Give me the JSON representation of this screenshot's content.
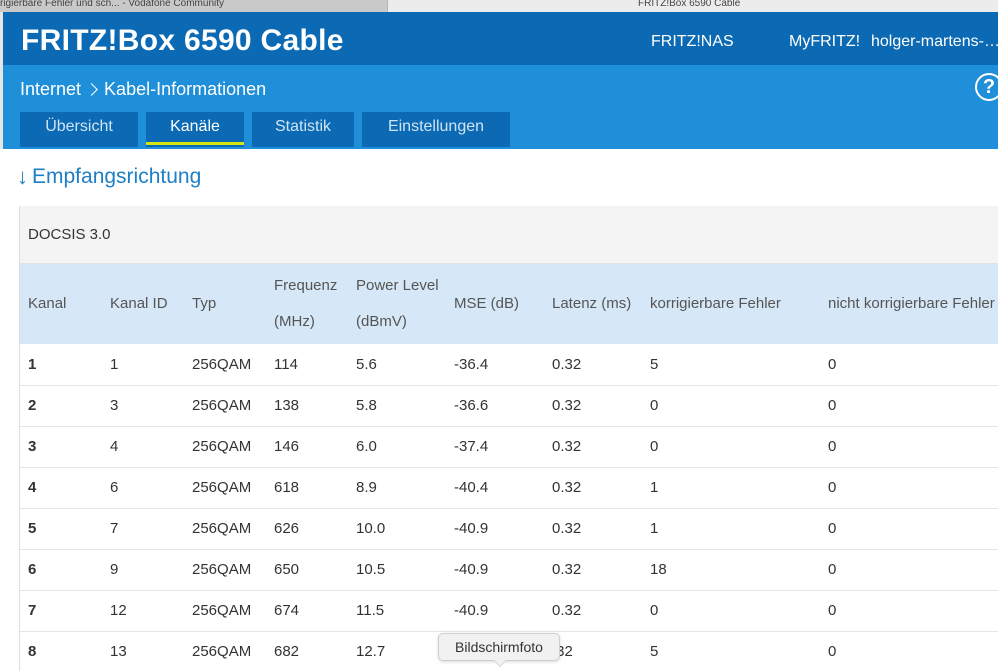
{
  "browser_tabs": [
    {
      "label": "rigierbare Fehler und sch... - Vodafone Community"
    },
    {
      "label": "FRITZ!Box 6590 Cable"
    }
  ],
  "header": {
    "brand": "FRITZ!Box 6590 Cable",
    "links": {
      "nas": "FRITZ!NAS",
      "myfritz": "MyFRITZ!",
      "user": "holger-martens-lo..."
    }
  },
  "breadcrumb": {
    "parent": "Internet",
    "current": "Kabel-Informationen"
  },
  "help_label": "?",
  "tabs": [
    {
      "label": "Übersicht",
      "active": false
    },
    {
      "label": "Kanäle",
      "active": true
    },
    {
      "label": "Statistik",
      "active": false
    },
    {
      "label": "Einstellungen",
      "active": false
    }
  ],
  "section": {
    "arrow": "↓",
    "title": "Empfangsrichtung"
  },
  "table": {
    "panel_title": "DOCSIS 3.0",
    "headers": [
      {
        "line1": "Kanal",
        "line2": ""
      },
      {
        "line1": "Kanal ID",
        "line2": ""
      },
      {
        "line1": "Typ",
        "line2": ""
      },
      {
        "line1": "Frequenz",
        "line2": "(MHz)"
      },
      {
        "line1": "Power Level",
        "line2": "(dBmV)"
      },
      {
        "line1": "MSE (dB)",
        "line2": ""
      },
      {
        "line1": "Latenz (ms)",
        "line2": ""
      },
      {
        "line1": "korrigierbare Fehler",
        "line2": ""
      },
      {
        "line1": "nicht korrigierbare Fehler",
        "line2": ""
      }
    ],
    "rows": [
      [
        "1",
        "1",
        "256QAM",
        "114",
        "5.6",
        "-36.4",
        "0.32",
        "5",
        "0"
      ],
      [
        "2",
        "3",
        "256QAM",
        "138",
        "5.8",
        "-36.6",
        "0.32",
        "0",
        "0"
      ],
      [
        "3",
        "4",
        "256QAM",
        "146",
        "6.0",
        "-37.4",
        "0.32",
        "0",
        "0"
      ],
      [
        "4",
        "6",
        "256QAM",
        "618",
        "8.9",
        "-40.4",
        "0.32",
        "1",
        "0"
      ],
      [
        "5",
        "7",
        "256QAM",
        "626",
        "10.0",
        "-40.9",
        "0.32",
        "1",
        "0"
      ],
      [
        "6",
        "9",
        "256QAM",
        "650",
        "10.5",
        "-40.9",
        "0.32",
        "18",
        "0"
      ],
      [
        "7",
        "12",
        "256QAM",
        "674",
        "11.5",
        "-40.9",
        "0.32",
        "0",
        "0"
      ],
      [
        "8",
        "13",
        "256QAM",
        "682",
        "12.7",
        "",
        ".32",
        "5",
        "0"
      ]
    ]
  },
  "tooltip": "Bildschirmfoto",
  "colors": {
    "header": "#0b6ab3",
    "subheader": "#1e8fd8",
    "tab_underline": "#d4e60e",
    "table_head": "#d6e8f7"
  }
}
